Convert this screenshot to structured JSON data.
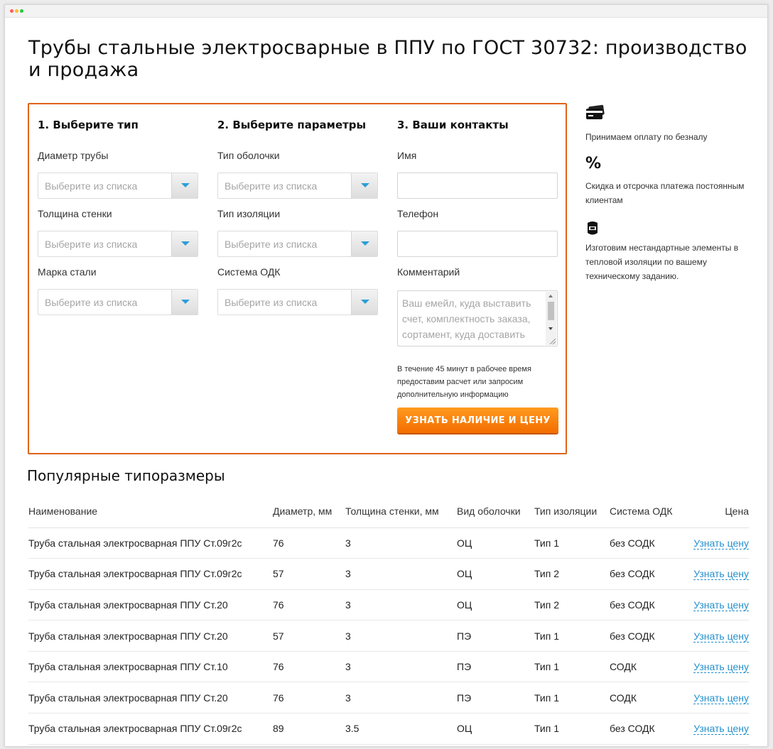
{
  "page": {
    "title": "Трубы стальные электросварные в ППУ по ГОСТ 30732: производство и продажа"
  },
  "form": {
    "col1": {
      "heading": "1. Выберите тип",
      "fields": [
        {
          "label": "Диаметр трубы",
          "placeholder": "Выберите из списка"
        },
        {
          "label": "Толщина стенки",
          "placeholder": "Выберите из списка"
        },
        {
          "label": "Марка стали",
          "placeholder": "Выберите из списка"
        }
      ]
    },
    "col2": {
      "heading": "2. Выберите параметры",
      "fields": [
        {
          "label": "Тип оболочки",
          "placeholder": "Выберите из списка"
        },
        {
          "label": "Тип изоляции",
          "placeholder": "Выберите из списка"
        },
        {
          "label": "Система ОДК",
          "placeholder": "Выберите из списка"
        }
      ]
    },
    "col3": {
      "heading": "3. Ваши контакты",
      "name_label": "Имя",
      "phone_label": "Телефон",
      "comment_label": "Комментарий",
      "comment_placeholder": "Ваш емейл, куда выставить счет, комплектность заказа, сортамент, куда доставить",
      "note": "В течение 45 минут в рабочее время предоставим расчет или запросим дополнительную информацию",
      "submit_label": "УЗНАТЬ НАЛИЧИЕ И ЦЕНУ"
    },
    "accent_color": "#e0631a",
    "cta_color": "#f7820f"
  },
  "benefits": [
    {
      "icon": "credit-card-icon",
      "text": "Принимаем оплату по безналу"
    },
    {
      "icon": "percent-icon",
      "text": "Скидка и отсрочка платежа постоянным клиентам"
    },
    {
      "icon": "welding-mask-icon",
      "text": "Изготовим нестандартные элементы в тепловой изоляции по вашему техническому заданию."
    }
  ],
  "popular": {
    "title": "Популярные типоразмеры",
    "headers": [
      "Наименование",
      "Диаметр, мм",
      "Толщина стенки, мм",
      "Вид оболочки",
      "Тип изоляции",
      "Система ОДК",
      "Цена"
    ],
    "rows": [
      [
        "Труба стальная электросварная ППУ Ст.09г2с",
        "76",
        "3",
        "ОЦ",
        "Тип 1",
        "без СОДК",
        "Узнать цену"
      ],
      [
        "Труба стальная электросварная ППУ Ст.09г2с",
        "57",
        "3",
        "ОЦ",
        "Тип 2",
        "без СОДК",
        "Узнать цену"
      ],
      [
        "Труба стальная электросварная ППУ Ст.20",
        "76",
        "3",
        "ОЦ",
        "Тип 2",
        "без СОДК",
        "Узнать цену"
      ],
      [
        "Труба стальная электросварная ППУ Ст.20",
        "57",
        "3",
        "ПЭ",
        "Тип 1",
        "без СОДК",
        "Узнать цену"
      ],
      [
        "Труба стальная электросварная ППУ Ст.10",
        "76",
        "3",
        "ПЭ",
        "Тип 1",
        "СОДК",
        "Узнать цену"
      ],
      [
        "Труба стальная электросварная ППУ Ст.20",
        "76",
        "3",
        "ПЭ",
        "Тип 1",
        "СОДК",
        "Узнать цену"
      ],
      [
        "Труба стальная электросварная ППУ Ст.09г2с",
        "89",
        "3.5",
        "ОЦ",
        "Тип 1",
        "без СОДК",
        "Узнать цену"
      ]
    ],
    "link_color": "#2590cc"
  }
}
